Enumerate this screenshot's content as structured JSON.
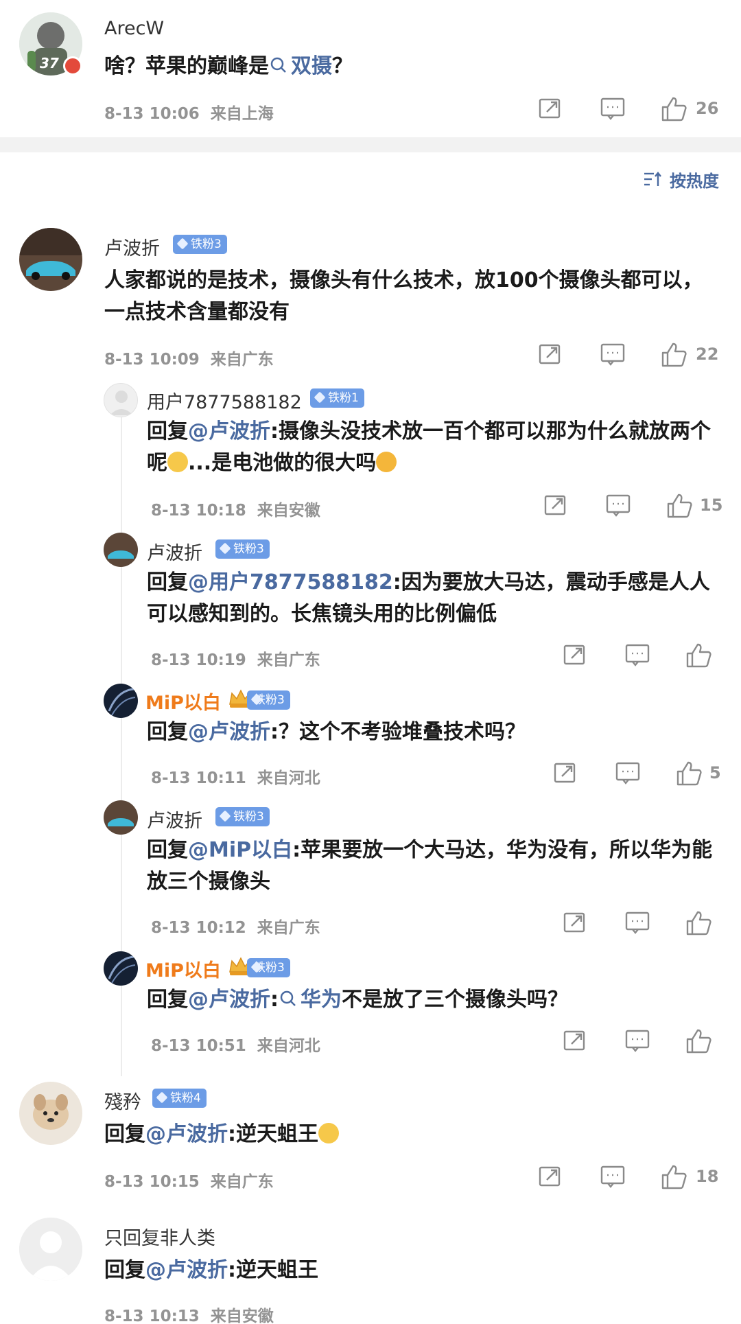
{
  "comments": [
    {
      "user": "ArecW",
      "text_parts": {
        "a": "啥？苹果的巅峰是",
        "topic": "双摄",
        "b": "？"
      },
      "time": "8-13 10:06",
      "loc": "来自上海",
      "likes": "26",
      "avatar_count": "37"
    },
    {
      "user": "卢波折",
      "badge": "铁粉3",
      "text": "人家都说的是技术，摄像头有什么技术，放100个摄像头都可以，一点技术含量都没有",
      "time": "8-13 10:09",
      "loc": "来自广东",
      "likes": "22"
    },
    {
      "user": "殘矜",
      "badge": "铁粉4",
      "reply_prefix": "回复",
      "at": "@卢波折",
      "text": ":逆天蛆王",
      "time": "8-13 10:15",
      "loc": "来自广东",
      "likes": "18"
    },
    {
      "user": "只回复非人类",
      "reply_prefix": "回复",
      "at": "@卢波折",
      "text": ":逆天蛆王",
      "time": "8-13 10:13",
      "loc": "来自安徽"
    }
  ],
  "replies": [
    {
      "user": "用户7877588182",
      "badge": "铁粉1",
      "reply_prefix": "回复",
      "at": "@卢波折",
      "text": ":摄像头没技术放一百个都可以那为什么就放两个呢",
      "text2": "...是电池做的很大吗",
      "time": "8-13 10:18",
      "loc": "来自安徽",
      "likes": "15"
    },
    {
      "user": "卢波折",
      "badge": "铁粉3",
      "reply_prefix": "回复",
      "at": "@用户7877588182",
      "text": ":因为要放大马达，震动手感是人人可以感知到的。长焦镜头用的比例偏低",
      "time": "8-13 10:19",
      "loc": "来自广东",
      "likes": ""
    },
    {
      "user": "MiP以白",
      "badge": "铁粉3",
      "reply_prefix": "回复",
      "at": "@卢波折",
      "text": ":？这个不考验堆叠技术吗？",
      "time": "8-13 10:11",
      "loc": "来自河北",
      "likes": "5"
    },
    {
      "user": "卢波折",
      "badge": "铁粉3",
      "reply_prefix": "回复",
      "at": "@MiP以白",
      "text": ":苹果要放一个大马达，华为没有，所以华为能 放三个摄像头",
      "time": "8-13 10:12",
      "loc": "来自广东",
      "likes": ""
    },
    {
      "user": "MiP以白",
      "badge": "铁粉3",
      "reply_prefix": "回复",
      "at": "@卢波折",
      "text_colon": ":",
      "topic": "华为",
      "text": "不是放了三个摄像头吗？",
      "time": "8-13 10:51",
      "loc": "来自河北",
      "likes": ""
    }
  ],
  "sort_label": "按热度",
  "icons": [
    "share-icon",
    "comment-icon",
    "like-icon",
    "search-icon",
    "sort-icon"
  ],
  "colors": {
    "link": "#4a6aa0",
    "vip_name": "#ef7b1b",
    "badge": "#6c9ce6",
    "meta": "#939393"
  }
}
